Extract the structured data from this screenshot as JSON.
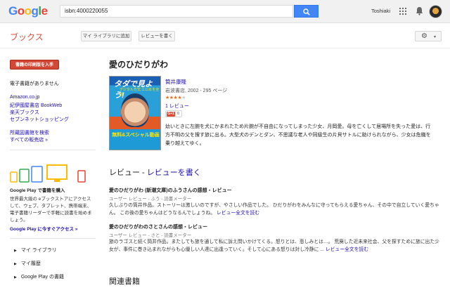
{
  "header": {
    "logo_letters": [
      "G",
      "o",
      "o",
      "g",
      "l",
      "e"
    ],
    "search_value": "isbn:4000220055",
    "user_name": "Toshiaki"
  },
  "subbar": {
    "title": "ブックス",
    "add_library_label": "マイ ライブラリに追加",
    "write_review_label": "レビューを書く"
  },
  "sidebar": {
    "print_button": "書籍の印刷版を入手",
    "no_ebook": "電子書籍がありません",
    "stores": [
      "Amazon.co.jp",
      "紀伊國屋書店 BookWeb",
      "楽天ブックス",
      "セブンネットショッピング"
    ],
    "library_links": [
      "所蔵図書館を検索",
      "すべての販売店 »"
    ],
    "play_heading": "Google Play で書籍を購入",
    "play_desc": "世界最大級の eブックストアにアクセスして、ウェブ、タブレット、携帯端末、電子書籍リーダーで手軽に読書を始めましょう。",
    "play_link": "Google Play に今すぐアクセス »",
    "nav": [
      "マイ ライブラリ",
      "マイ履歴",
      "Google Play の書籍"
    ]
  },
  "book": {
    "title": "愛のひだりがわ",
    "cover_title": "タダで見よう!",
    "cover_subtitle": "デジタル方式 エロ本を全部",
    "cover_bottom": "無料&スペシャル動画",
    "author": "筒井康隆",
    "publisher_line": "岩波書店, 2002 - 295 ページ",
    "rating": 4,
    "rating_max": 5,
    "review_count_label": "1 レビュー",
    "gplus_label": "G+1",
    "gplus_count": "0",
    "description": "幼いときに左腕を犬にかまれたため片腕が不自由になってしまった少女、月岡愛。母を亡くして居場所を失った愛は、行方不明の父を捜す旅に出る。大型犬のデンとダン、不思議な老人や同級生の片貝サトルに助けられながら、少女は危機を乗り越えてゆく。"
  },
  "reviews": {
    "heading_prefix": "レビュー - ",
    "heading_link": "レビューを書く",
    "items": [
      {
        "title": "愛のひだりがわ (新潮文庫)のふうさんの感想・レビュー",
        "meta": "ユーザー レビュー - ふう - 読書メーター",
        "body": "久しぶりの筒井作品。ストーリーは激しいのですが、やさしい作品でした。 ひだりがわをみんなに守ってもらえる愛ちゃん、その中で自立していく愛ちゃん。 この後の愛ちゃんはどうなるんでしょうね。",
        "more": "レビュー全文を読む"
      },
      {
        "title": "愛のひだりがわのさとさんの感想・レビュー",
        "meta": "ユーザー レビュー - さと - 読書メーター",
        "body": "旅のラゴスと続く筒井作品。またしても旅を通して私に訴え問いかけてくる。怒りとは、悲しみとは…。 荒廃した近未来社会、父を探すために旅に出た少女が、事件に巻き込まれながらも心優しい人達に出逢っていく。そして心にある怒りは対し冷静に ...",
        "more": "レビュー全文を読む"
      }
    ]
  },
  "related": {
    "heading": "関連書籍"
  }
}
